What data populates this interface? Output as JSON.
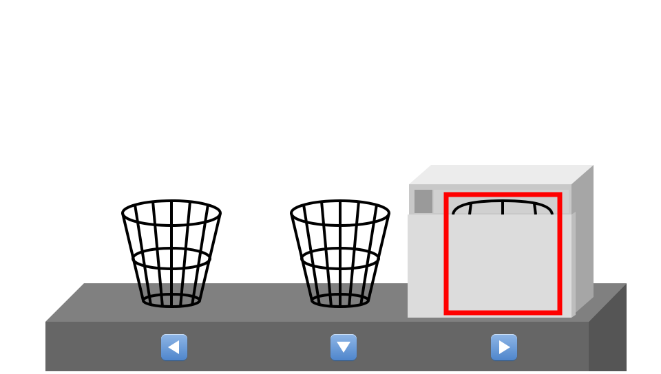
{
  "scene": {
    "colors": {
      "background": "#ffffff",
      "counter_top": "#808080",
      "counter_front": "#666666",
      "counter_side": "#555555",
      "basket_stroke": "#000000",
      "box_light": "#dcdcdc",
      "box_top": "#ececec",
      "box_side": "#a6a6a6",
      "selection": "#ff0000",
      "button": "#5b8fd1"
    },
    "baskets": [
      {
        "id": "basket-1",
        "state": "open"
      },
      {
        "id": "basket-2",
        "state": "open"
      },
      {
        "id": "basket-3",
        "state": "covered-by-box"
      }
    ],
    "selected_basket": 3,
    "controls": [
      {
        "id": "move-left",
        "icon": "triangle-left-icon"
      },
      {
        "id": "drop-down",
        "icon": "triangle-down-icon"
      },
      {
        "id": "move-right",
        "icon": "triangle-right-icon"
      }
    ]
  }
}
